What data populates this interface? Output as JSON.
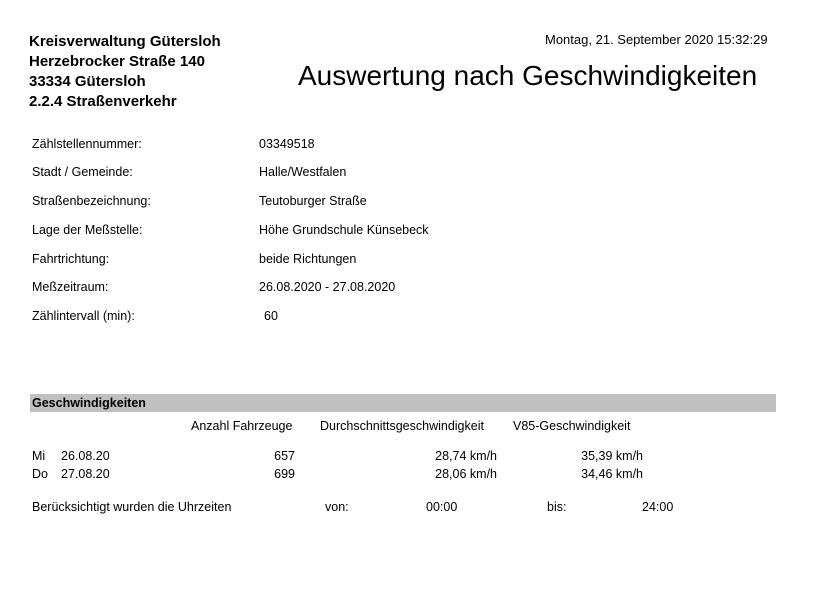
{
  "header": {
    "org_lines": [
      "Kreisverwaltung Gütersloh",
      "Herzebrocker Straße 140",
      "33334 Gütersloh",
      "2.2.4 Straßenverkehr"
    ],
    "date": "Montag, 21. September 2020 15:32:29",
    "title": "Auswertung nach Geschwindigkeiten"
  },
  "info": [
    {
      "label": "Zählstellennummer:",
      "value": "03349518"
    },
    {
      "label": "Stadt / Gemeinde:",
      "value": "Halle/Westfalen"
    },
    {
      "label": "Straßenbezeichnung:",
      "value": "Teutoburger Straße"
    },
    {
      "label": "Lage der Meßstelle:",
      "value": "Höhe Grundschule Künsebeck"
    },
    {
      "label": "Fahrtrichtung:",
      "value": "beide Richtungen"
    },
    {
      "label": "Meßzeitraum:",
      "value": "26.08.2020 - 27.08.2020"
    },
    {
      "label": "Zählintervall (min):",
      "value": "60"
    }
  ],
  "section": {
    "title": "Geschwindigkeiten",
    "columns": [
      "Anzahl Fahrzeuge",
      "Durchschnittsgeschwindigkeit",
      "V85-Geschwindigkeit"
    ],
    "rows": [
      {
        "day": "Mi",
        "date": "26.08.20",
        "count": "657",
        "avg": "28,74 km/h",
        "v85": "35,39 km/h"
      },
      {
        "day": "Do",
        "date": "27.08.20",
        "count": "699",
        "avg": "28,06 km/h",
        "v85": "34,46 km/h"
      }
    ]
  },
  "note": {
    "text": "Berücksichtigt wurden die Uhrzeiten",
    "from_label": "von:",
    "from_value": "00:00",
    "to_label": "bis:",
    "to_value": "24:00"
  }
}
